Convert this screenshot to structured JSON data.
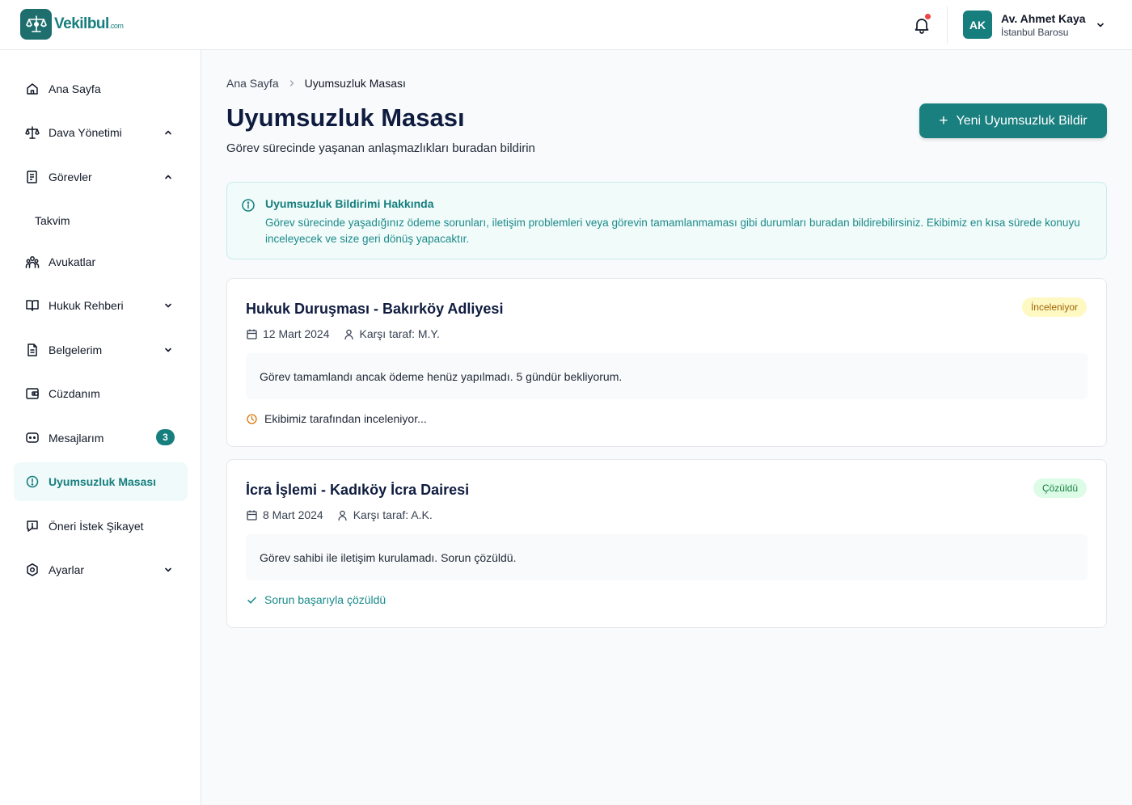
{
  "brand": {
    "name": "Vekilbul",
    "suffix": ".com",
    "color": "#177e7e"
  },
  "topbar": {
    "notifications_icon": "bell-icon",
    "has_unread": true,
    "user": {
      "initials": "AK",
      "name": "Av. Ahmet Kaya",
      "org": "İstanbul Barosu"
    }
  },
  "sidebar": {
    "items": [
      {
        "label": "Ana Sayfa",
        "icon": "home-icon"
      },
      {
        "label": "Dava Yönetimi",
        "icon": "scale-icon",
        "expanded": true
      },
      {
        "label": "Görevler",
        "icon": "tasks-icon",
        "expanded": true
      },
      {
        "label": "Takvim",
        "sub": true
      },
      {
        "label": "Avukatlar",
        "icon": "users-icon"
      },
      {
        "label": "Hukuk Rehberi",
        "icon": "book-icon",
        "expanded": false
      },
      {
        "label": "Belgelerim",
        "icon": "document-icon",
        "expanded": false
      },
      {
        "label": "Cüzdanım",
        "icon": "wallet-icon"
      },
      {
        "label": "Mesajlarım",
        "icon": "message-icon",
        "badge": "3"
      },
      {
        "label": "Uyumsuzluk Masası",
        "icon": "alert-circle-icon",
        "active": true
      },
      {
        "label": "Öneri İstek Şikayet",
        "icon": "feedback-icon"
      },
      {
        "label": "Ayarlar",
        "icon": "settings-icon",
        "expanded": false
      }
    ]
  },
  "breadcrumb": {
    "home": "Ana Sayfa",
    "current": "Uyumsuzluk Masası"
  },
  "page": {
    "title": "Uyumsuzluk Masası",
    "subtitle": "Görev sürecinde yaşanan anlaşmazlıkları buradan bildirin",
    "new_button": "Yeni Uyumsuzluk Bildir"
  },
  "info": {
    "title": "Uyumsuzluk Bildirimi Hakkında",
    "text": "Görev sürecinde yaşadığınız ödeme sorunları, iletişim problemleri veya görevin tamamlanmaması gibi durumları buradan bildirebilirsiniz. Ekibimiz en kısa sürede konuyu inceleyecek ve size geri dönüş yapacaktır."
  },
  "reports": [
    {
      "title": "Hukuk Duruşması - Bakırköy Adliyesi",
      "status": "İnceleniyor",
      "date": "12 Mart 2024",
      "counterparty": "Karşı taraf: M.Y.",
      "description": "Görev tamamlandı ancak ödeme henüz yapılmadı. 5 gündür bekliyorum.",
      "footer": "Ekibimiz tarafından inceleniyor..."
    },
    {
      "title": "İcra İşlemi - Kadıköy İcra Dairesi",
      "status": "Çözüldü",
      "date": "8 Mart 2024",
      "counterparty": "Karşı taraf: A.K.",
      "description": "Görev sahibi ile iletişim kurulamadı. Sorun çözüldü.",
      "footer": "Sorun başarıyla çözüldü"
    }
  ]
}
